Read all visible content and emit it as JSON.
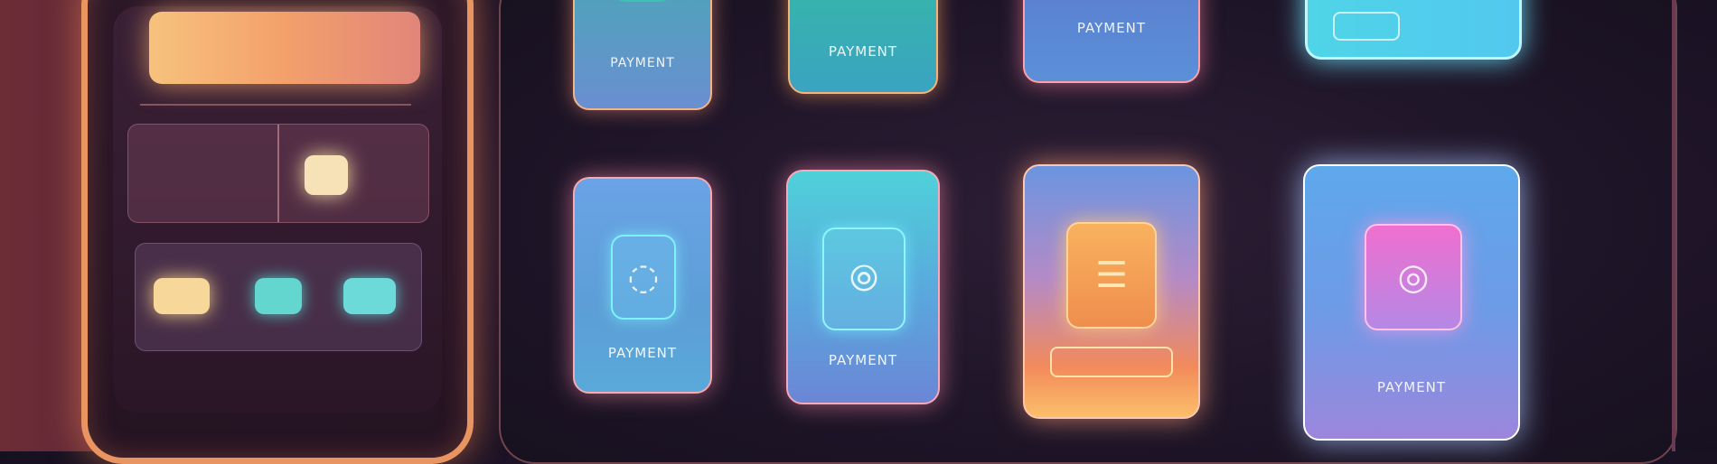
{
  "phone": {
    "panel_left": {
      "label": "",
      "value": ""
    },
    "panel_right": {
      "label": "",
      "value": ""
    },
    "buttons": [
      "",
      "",
      ""
    ]
  },
  "grid": {
    "top_row": [
      {
        "label": "PAYMENT",
        "accent": "#f0b48a"
      },
      {
        "label": "PAYMENT",
        "accent": "#f5b27a"
      },
      {
        "label": "PAYMENT",
        "accent": "#ff9fa8"
      },
      {
        "label": "",
        "pill": "",
        "accent": "#bff6ff"
      }
    ],
    "bottom_row": [
      {
        "header": "",
        "label": "PAYMENT",
        "icon": "contactless-icon"
      },
      {
        "header": "",
        "label": "PAYMENT",
        "icon": "fingerprint-icon"
      },
      {
        "header": "",
        "label": "",
        "icon": "chip-icon"
      },
      {
        "header": "",
        "label": "PAYMENT",
        "icon": "nfc-icon"
      }
    ]
  },
  "icons": {
    "contactless": "◌",
    "fingerprint": "⦾",
    "chip": "☰",
    "nfc": "◎"
  },
  "colors": {
    "phone_border": "#e99561",
    "chip": "#f7e1b6",
    "teal": "#63d6cf"
  }
}
